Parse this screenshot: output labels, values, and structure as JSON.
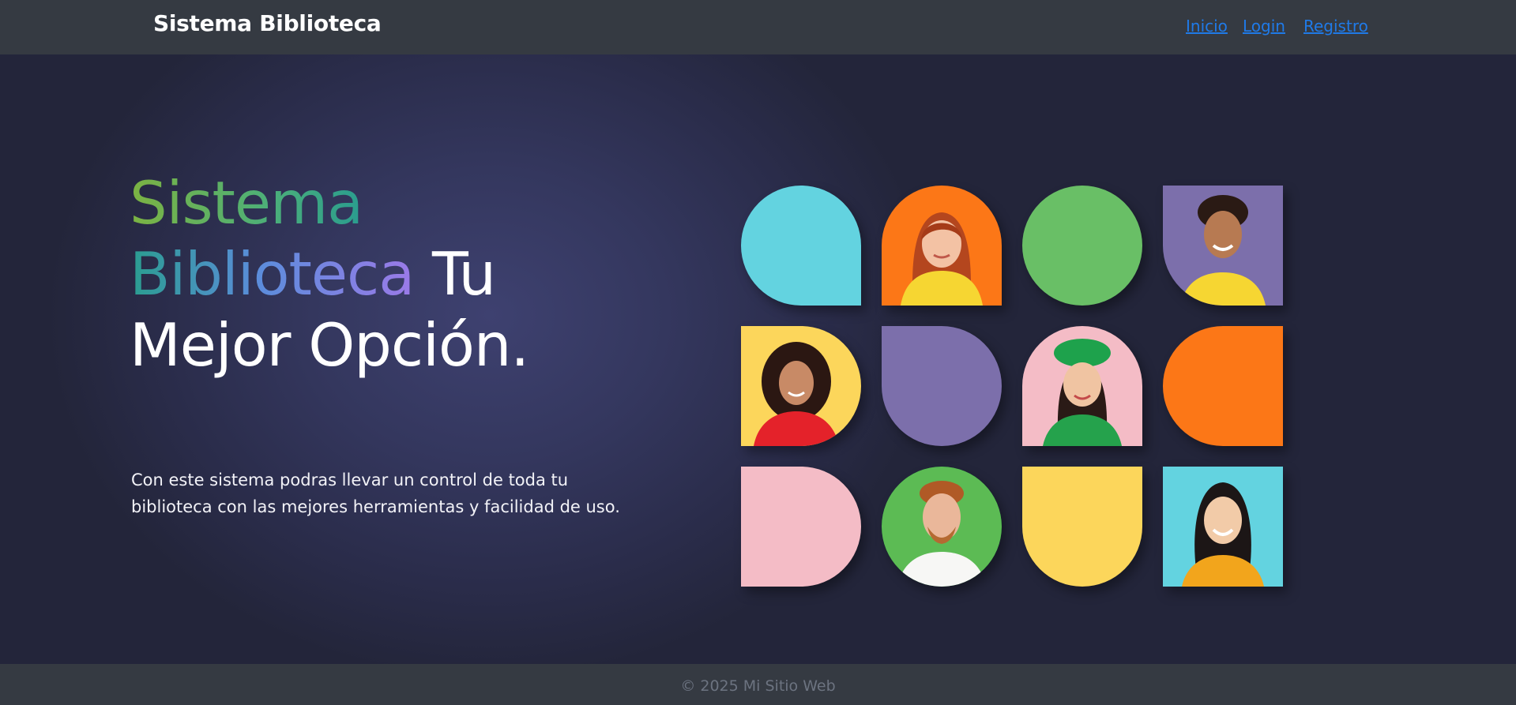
{
  "nav": {
    "brand": "Sistema Biblioteca",
    "links": [
      "Inicio",
      "Login",
      "Registro"
    ]
  },
  "hero": {
    "headline": {
      "part1": "Sistema",
      "part2": "Biblioteca",
      "part3": " Tu",
      "part4": "Mejor Opción."
    },
    "subtitle": "Con este sistema podras llevar un control de toda tu biblioteca con las mejores herramientas y facilidad de uso."
  },
  "footer": {
    "copyright": "© 2025 Mi Sitio Web"
  },
  "colors": {
    "navbar": "#353a42",
    "link": "#1f7ae8",
    "cyan": "#63d3e0",
    "orange": "#fc7717",
    "green": "#69bf66",
    "purple": "#7c6fab",
    "yellow": "#fcd65b",
    "pink": "#f4bcc6"
  },
  "grid_tiles": [
    {
      "name": "tile-cyan-shape",
      "kind": "shape",
      "color": "cyan"
    },
    {
      "name": "tile-photo-redhead-woman",
      "kind": "photo",
      "color": "orange"
    },
    {
      "name": "tile-green-circle",
      "kind": "shape",
      "color": "green"
    },
    {
      "name": "tile-photo-young-man",
      "kind": "photo",
      "color": "purple"
    },
    {
      "name": "tile-photo-curly-woman",
      "kind": "photo",
      "color": "yellow"
    },
    {
      "name": "tile-purple-shape",
      "kind": "shape",
      "color": "purple"
    },
    {
      "name": "tile-photo-woman-beret",
      "kind": "photo",
      "color": "pink"
    },
    {
      "name": "tile-orange-shape",
      "kind": "shape",
      "color": "orange"
    },
    {
      "name": "tile-pink-shape",
      "kind": "shape",
      "color": "pink"
    },
    {
      "name": "tile-photo-bearded-man",
      "kind": "photo",
      "color": "green"
    },
    {
      "name": "tile-yellow-shape",
      "kind": "shape",
      "color": "yellow"
    },
    {
      "name": "tile-photo-smiling-woman",
      "kind": "photo",
      "color": "cyan"
    }
  ]
}
